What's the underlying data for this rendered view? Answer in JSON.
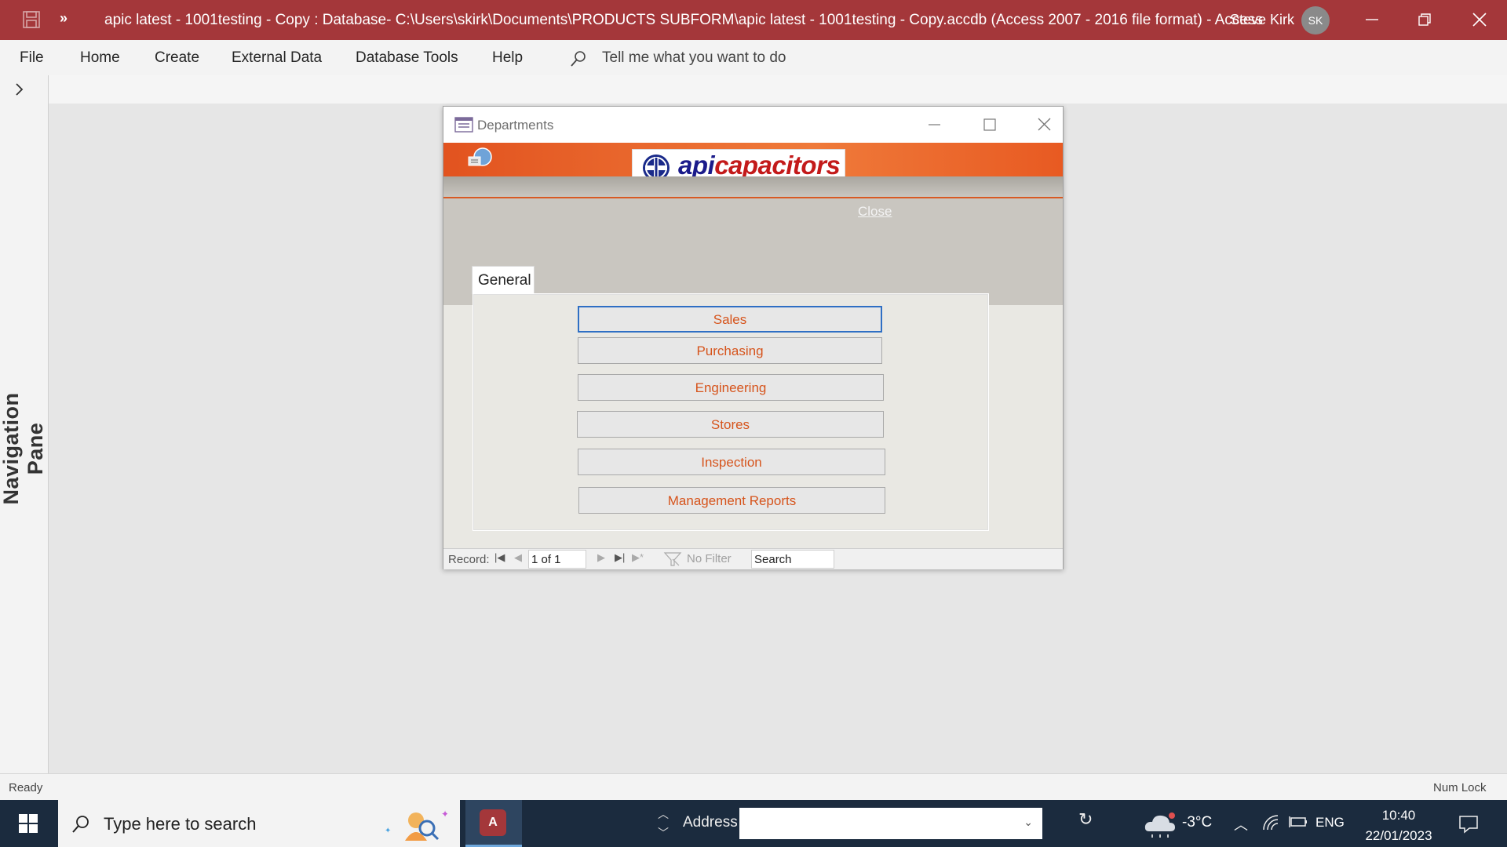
{
  "app": {
    "title": "apic latest - 1001testing - Copy : Database- C:\\Users\\skirk\\Documents\\PRODUCTS SUBFORM\\apic latest - 1001testing - Copy.accdb (Access 2007 - 2016 file format)  -  Access",
    "user_name": "Steve Kirk",
    "user_initials": "SK",
    "accent": "#a4373a"
  },
  "ribbon": {
    "tabs": [
      "File",
      "Home",
      "Create",
      "External Data",
      "Database Tools",
      "Help"
    ],
    "tell_me": "Tell me what you want to do"
  },
  "nav_pane": {
    "label": "Navigation Pane"
  },
  "form": {
    "title": "Departments",
    "logo_part1": "api",
    "logo_part2": "capacitors",
    "close_label": "Close",
    "tab_label": "General",
    "buttons": [
      "Sales",
      "Purchasing",
      "Engineering",
      "Stores",
      "Inspection",
      "Management Reports"
    ],
    "record_label": "Record:",
    "record_position": "1 of 1",
    "filter_label": "No Filter",
    "search_label": "Search"
  },
  "status": {
    "left": "Ready",
    "right": "Num Lock"
  },
  "taskbar": {
    "search_placeholder": "Type here to search",
    "address_label": "Address",
    "temperature": "-3°C",
    "language": "ENG",
    "time": "10:40",
    "date": "22/01/2023"
  }
}
